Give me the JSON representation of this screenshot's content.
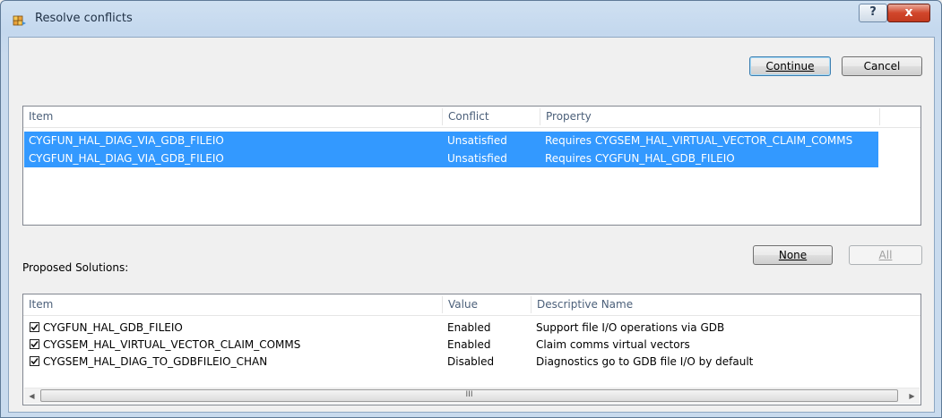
{
  "window": {
    "title": "Resolve conflicts",
    "help_label": "?",
    "close_label": "x"
  },
  "buttons": {
    "continue": "Continue",
    "cancel": "Cancel",
    "none": "None",
    "all": "All"
  },
  "conflicts": {
    "columns": [
      "Item",
      "Conflict",
      "Property"
    ],
    "rows": [
      {
        "item": "CYGFUN_HAL_DIAG_VIA_GDB_FILEIO",
        "conflict": "Unsatisfied",
        "property": "Requires CYGSEM_HAL_VIRTUAL_VECTOR_CLAIM_COMMS",
        "selected": true
      },
      {
        "item": "CYGFUN_HAL_DIAG_VIA_GDB_FILEIO",
        "conflict": "Unsatisfied",
        "property": "Requires CYGFUN_HAL_GDB_FILEIO",
        "selected": true
      }
    ]
  },
  "solutions": {
    "label": "Proposed Solutions:",
    "columns": [
      "Item",
      "Value",
      "Descriptive Name"
    ],
    "rows": [
      {
        "item": "CYGFUN_HAL_GDB_FILEIO",
        "value": "Enabled",
        "description": "Support file I/O operations via GDB",
        "checked": true
      },
      {
        "item": "CYGSEM_HAL_VIRTUAL_VECTOR_CLAIM_COMMS",
        "value": "Enabled",
        "description": "Claim comms virtual vectors",
        "checked": true
      },
      {
        "item": "CYGSEM_HAL_DIAG_TO_GDBFILEIO_CHAN",
        "value": "Disabled",
        "description": "Diagnostics go to GDB file I/O by default",
        "checked": true
      }
    ]
  },
  "scrollbar": {
    "left_arrow": "◀",
    "right_arrow": "▶",
    "thumb_grip": "III"
  },
  "colors": {
    "selection": "#3399ff",
    "title_bar": "#c4d8ee",
    "close_button": "#c33a1f"
  }
}
